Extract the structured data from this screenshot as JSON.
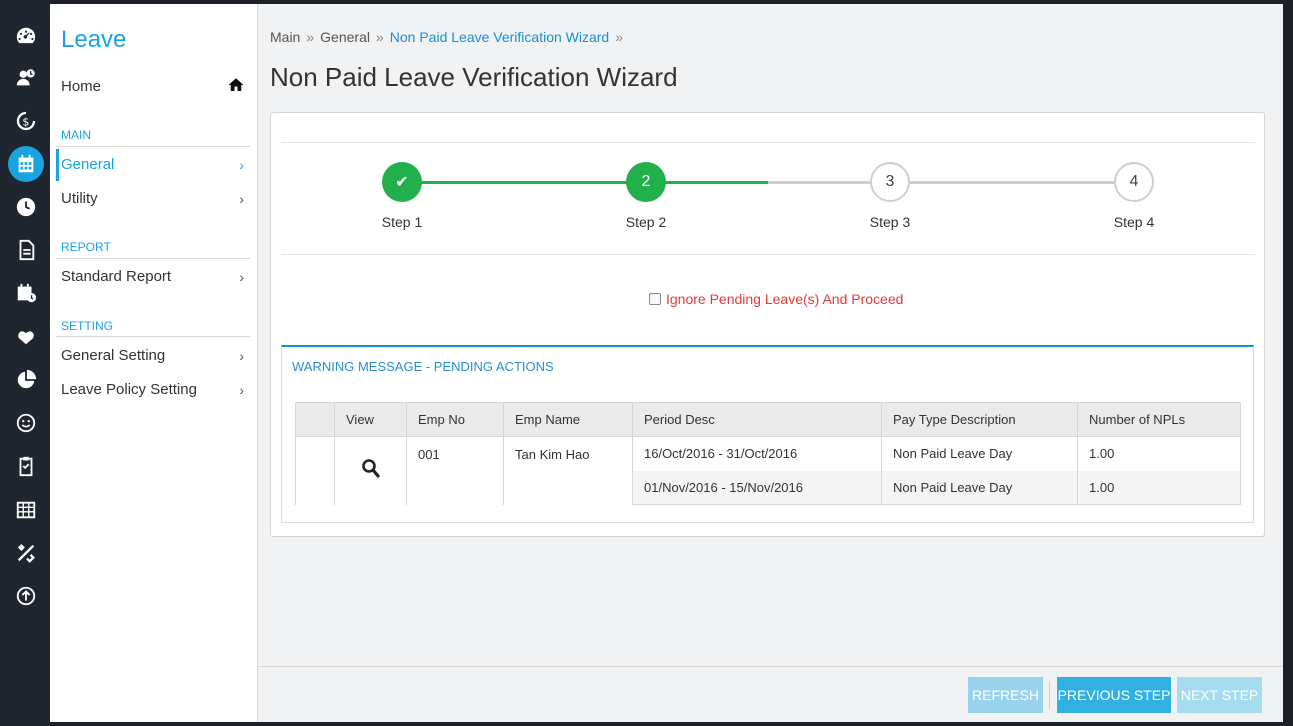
{
  "rail": {
    "icons": [
      "dashboard-icon",
      "user-clock-icon",
      "dollar-cycle-icon",
      "calendar-icon",
      "clock-icon",
      "document-icon",
      "calendar-clock-icon",
      "hand-heart-icon",
      "pie-chart-icon",
      "smile-icon",
      "clipboard-icon",
      "table-icon",
      "tools-icon",
      "arrow-up-circle-icon"
    ],
    "active": "calendar-icon"
  },
  "sidebar": {
    "title": "Leave",
    "home": "Home",
    "sections": [
      {
        "label": "MAIN",
        "items": [
          "General",
          "Utility"
        ]
      },
      {
        "label": "REPORT",
        "items": [
          "Standard Report"
        ]
      },
      {
        "label": "SETTING",
        "items": [
          "General Setting",
          "Leave Policy Setting"
        ]
      }
    ],
    "active_item": "General"
  },
  "breadcrumb": [
    "Main",
    "General",
    "Non Paid Leave Verification Wizard"
  ],
  "page_title": "Non Paid Leave Verification Wizard",
  "wizard": {
    "steps": [
      {
        "label": "Step 1",
        "marker": "✔",
        "state": "done"
      },
      {
        "label": "Step 2",
        "marker": "2",
        "state": "current"
      },
      {
        "label": "Step 3",
        "marker": "3",
        "state": "pending"
      },
      {
        "label": "Step 4",
        "marker": "4",
        "state": "pending"
      }
    ],
    "colors": {
      "done": "#21b04b",
      "pending": "#cfcfcf"
    }
  },
  "ignore_checkbox": {
    "label": "Ignore Pending Leave(s) And Proceed",
    "checked": false
  },
  "warning": {
    "title": "WARNING MESSAGE - PENDING ACTIONS",
    "columns": [
      "",
      "View",
      "Emp No",
      "Emp Name",
      "Period Desc",
      "Pay Type Description",
      "Number of NPLs"
    ],
    "emp_no": "001",
    "emp_name": "Tan Kim Hao",
    "rows": [
      {
        "period": "16/Oct/2016 - 31/Oct/2016",
        "pay_type": "Non Paid Leave Day",
        "npls": "1.00"
      },
      {
        "period": "01/Nov/2016 - 15/Nov/2016",
        "pay_type": "Non Paid Leave Day",
        "npls": "1.00"
      }
    ]
  },
  "buttons": {
    "refresh": "REFRESH",
    "previous": "PREVIOUS STEP",
    "next": "NEXT STEP"
  }
}
